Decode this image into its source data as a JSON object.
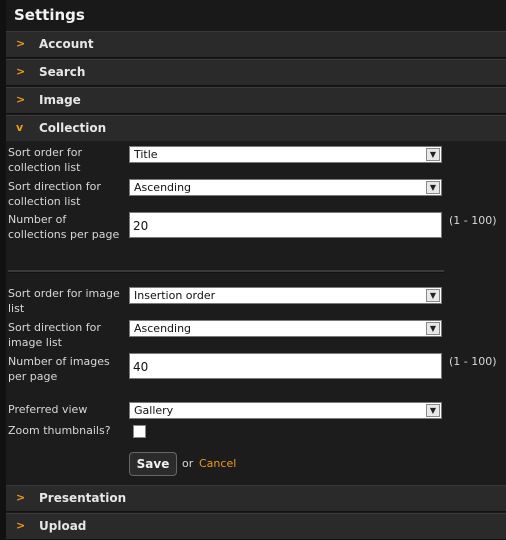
{
  "title": "Settings",
  "sections": {
    "account": {
      "chevron": ">",
      "label": "Account"
    },
    "search": {
      "chevron": ">",
      "label": "Search"
    },
    "image": {
      "chevron": ">",
      "label": "Image"
    },
    "collection": {
      "chevron": "v",
      "label": "Collection"
    },
    "presentation": {
      "chevron": ">",
      "label": "Presentation"
    },
    "upload": {
      "chevron": ">",
      "label": "Upload"
    }
  },
  "collection_settings": {
    "sort_order_collection_label": "Sort order for collection list",
    "sort_order_collection_value": "Title",
    "sort_direction_collection_label": "Sort direction for collection list",
    "sort_direction_collection_value": "Ascending",
    "collections_per_page_label": "Number of collections per page",
    "collections_per_page_value": "20",
    "collections_per_page_range": "(1 - 100)",
    "sort_order_image_label": "Sort order for image list",
    "sort_order_image_value": "Insertion order",
    "sort_direction_image_label": "Sort direction for image list",
    "sort_direction_image_value": "Ascending",
    "images_per_page_label": "Number of images per page",
    "images_per_page_value": "40",
    "images_per_page_range": "(1 - 100)",
    "preferred_view_label": "Preferred view",
    "preferred_view_value": "Gallery",
    "zoom_thumbnails_label": "Zoom thumbnails?",
    "zoom_thumbnails_checked": false
  },
  "actions": {
    "save_label": "Save",
    "or_text": "or",
    "cancel_label": "Cancel"
  },
  "colors": {
    "accent": "#f09a1a",
    "background": "#191919",
    "header_bg": "#2a2a2a"
  },
  "icons": {
    "collapsed": "chevron-right-icon",
    "expanded": "chevron-down-icon",
    "dropdown": "dropdown-arrow-icon"
  }
}
